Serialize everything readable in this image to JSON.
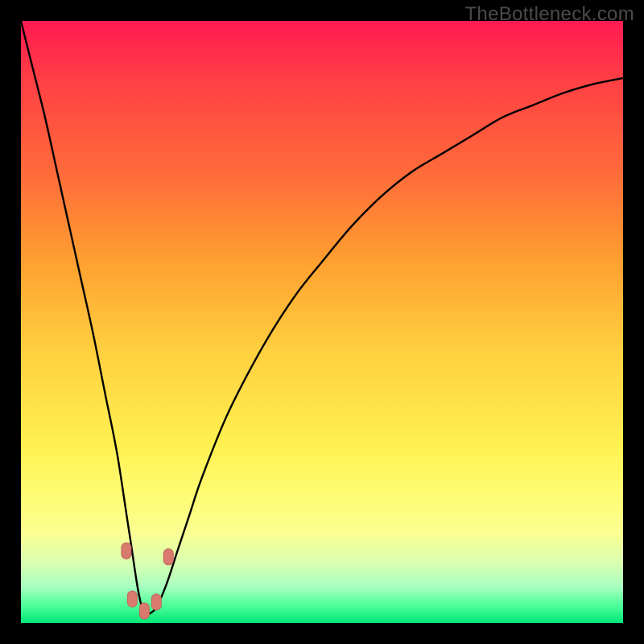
{
  "watermark": "TheBottleneck.com",
  "colors": {
    "background": "#000000",
    "gradient_top": "#ff1a52",
    "gradient_bottom": "#00e676",
    "curve": "#000000",
    "marker_fill": "#d97a6f"
  },
  "chart_data": {
    "type": "line",
    "title": "",
    "xlabel": "",
    "ylabel": "",
    "xlim": [
      0,
      100
    ],
    "ylim": [
      0,
      100
    ],
    "note": "Axes have no printed tick labels; values below are estimated percentages of the plot area (x left→right, y = curve height from bottom). The curve is a V/bottleneck profile with minimum near x≈21.",
    "series": [
      {
        "name": "bottleneck-curve",
        "x": [
          0,
          2,
          4,
          6,
          8,
          10,
          12,
          14,
          16,
          18,
          20,
          22,
          24,
          26,
          28,
          30,
          34,
          38,
          42,
          46,
          50,
          55,
          60,
          65,
          70,
          75,
          80,
          85,
          90,
          95,
          100
        ],
        "y": [
          100,
          92,
          84,
          75,
          66,
          57,
          48,
          38,
          28,
          15,
          3,
          2,
          6,
          12,
          18,
          24,
          34,
          42,
          49,
          55,
          60,
          66,
          71,
          75,
          78,
          81,
          84,
          86,
          88,
          89.5,
          90.5
        ]
      }
    ],
    "markers": [
      {
        "x": 17.5,
        "y": 12
      },
      {
        "x": 18.5,
        "y": 4
      },
      {
        "x": 20.5,
        "y": 2
      },
      {
        "x": 22.5,
        "y": 3.5
      },
      {
        "x": 24.5,
        "y": 11
      }
    ]
  }
}
